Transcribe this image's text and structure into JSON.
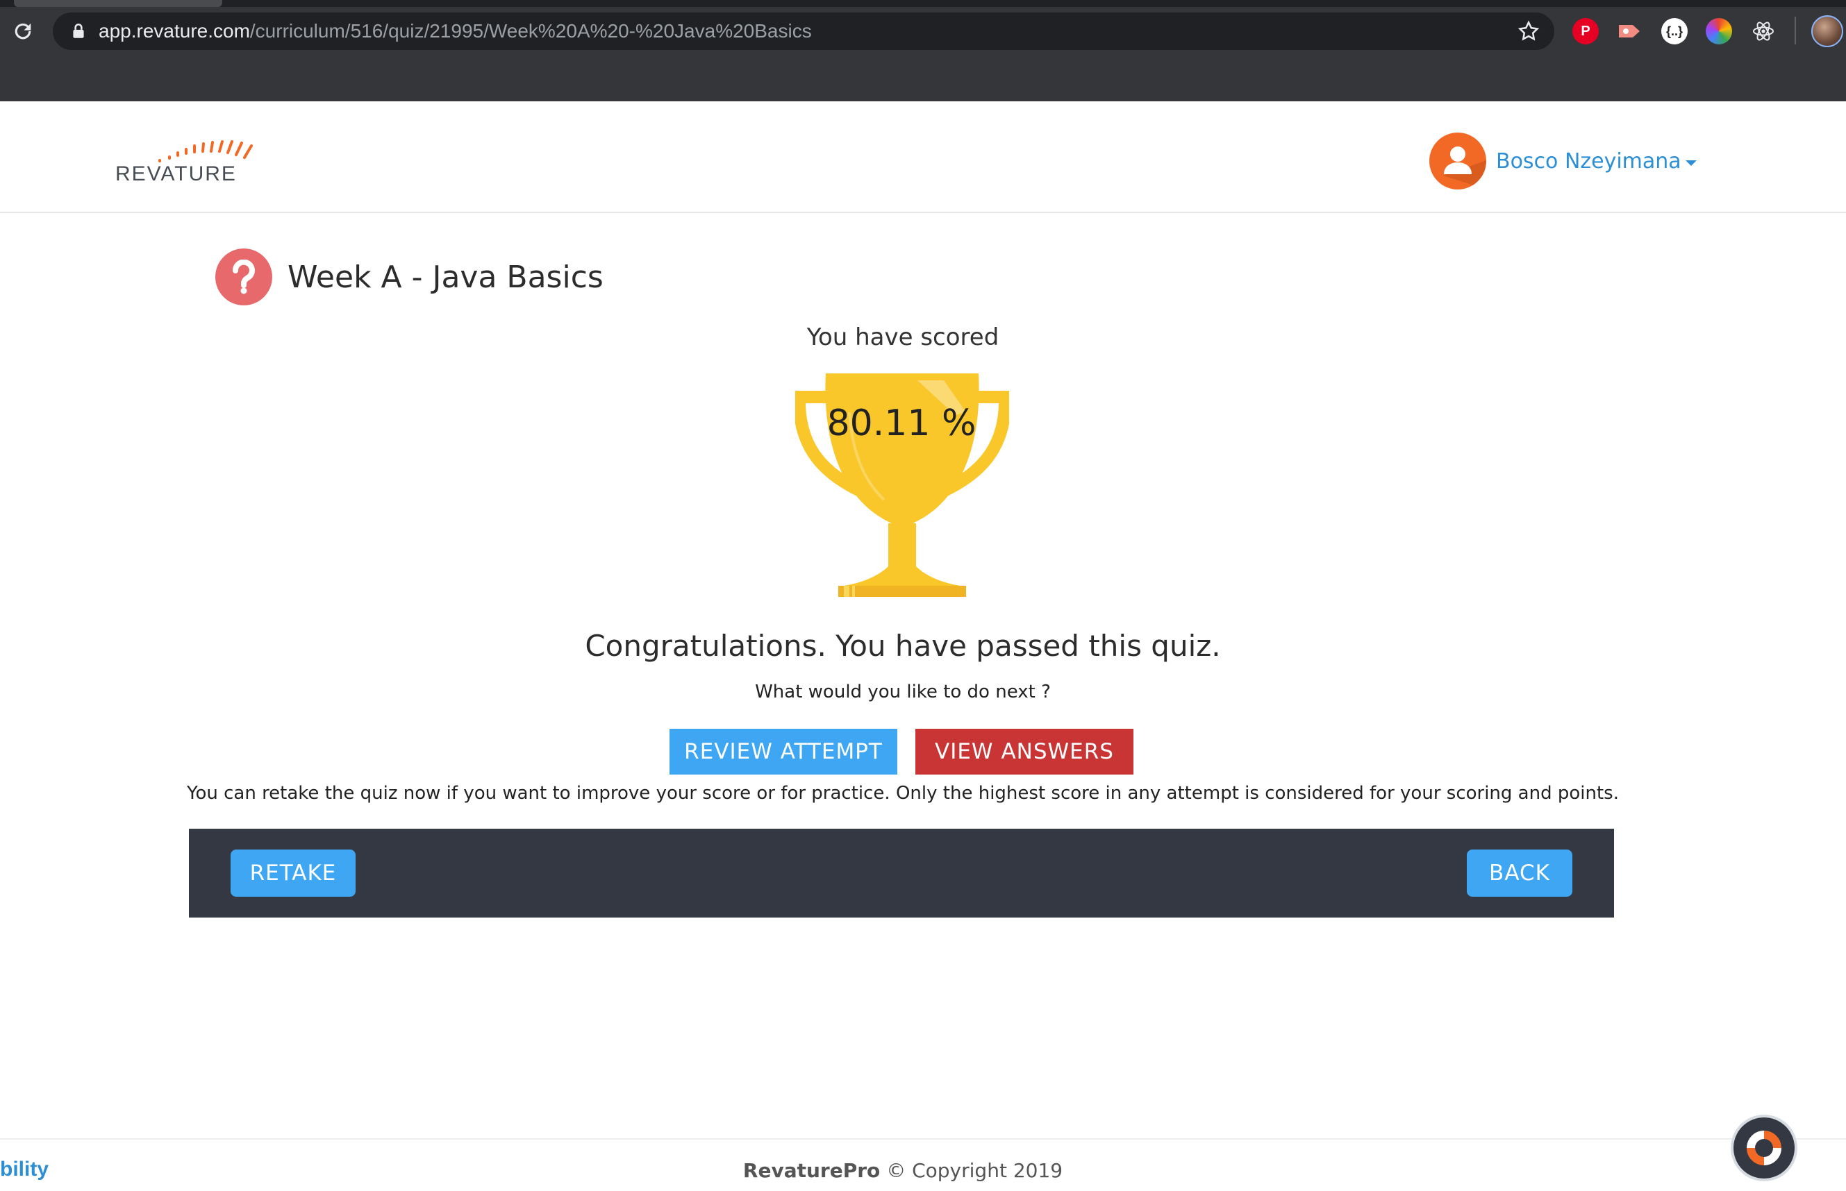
{
  "browser": {
    "url_host": "app.revature.com",
    "url_path": "/curriculum/516/quiz/21995/Week%20A%20-%20Java%20Basics",
    "extensions": [
      "pinterest-icon",
      "video-recorder-icon",
      "json-viewer-icon",
      "color-picker-icon",
      "react-devtools-icon"
    ]
  },
  "header": {
    "logo_text": "REVATURE",
    "user_name": "Bosco Nzeyimana"
  },
  "quiz": {
    "title": "Week A - Java Basics",
    "scored_label": "You have scored",
    "score": "80.11 %",
    "congrats": "Congratulations. You have passed this quiz.",
    "next_prompt": "What would you like to do next ?",
    "review_label": "REVIEW ATTEMPT",
    "answers_label": "VIEW ANSWERS",
    "retake_note": "You can retake the quiz now if you want to improve your score or for practice. Only the highest score in any attempt is considered for your scoring and points."
  },
  "actions": {
    "retake_label": "RETAKE",
    "back_label": "BACK"
  },
  "footer": {
    "left_fragment": "bility",
    "brand": "RevaturePro",
    "copyright": "© Copyright 2019"
  },
  "colors": {
    "accent_blue": "#3ea6f2",
    "danger_red": "#c93434",
    "action_bar": "#333842",
    "trophy_gold": "#f9c72a",
    "brand_orange": "#f26925"
  }
}
